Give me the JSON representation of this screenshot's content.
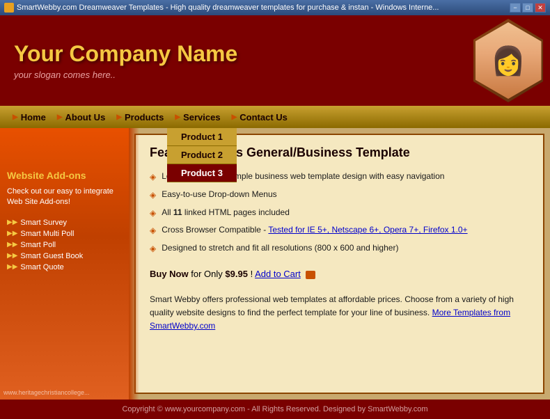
{
  "titlebar": {
    "text": "SmartWebby.com Dreamweaver Templates - High quality dreamweaver templates for purchase & instan - Windows Interne...",
    "minimize": "−",
    "maximize": "□",
    "close": "✕"
  },
  "header": {
    "company_name": "Your Company Name",
    "slogan": "your slogan comes here..",
    "person_emoji": "👩"
  },
  "nav": {
    "home": "Home",
    "about_us": "About Us",
    "products": "Products",
    "services": "Services",
    "contact_us": "Contact Us"
  },
  "dropdown": {
    "item1": "Product 1",
    "item2": "Product 2",
    "item3": "Product 3"
  },
  "sidebar": {
    "title": "Website Add-ons",
    "description": "Check out our easy to integrate Web Site Add-ons!",
    "links": [
      "Smart Survey",
      "Smart Multi Poll",
      "Smart Poll",
      "Smart Guest Book",
      "Smart Quote"
    ],
    "bottom_text": "www.heritagechristiancollege..."
  },
  "content": {
    "title": "Features of this General/Business Template",
    "features": [
      "Low-cost smart & simple business web template design with easy navigation",
      "Easy-to-use Drop-down Menus",
      "All 11 linked HTML pages included",
      "Cross Browser Compatible - Tested for IE 5+, Netscape 6+, Opera 7+, Firefox 1.0+",
      "Designed to stretch and fit all resolutions (800 x 600 and higher)"
    ],
    "feature_bold": "11",
    "cross_browser_label": "Cross Browser Compatible - ",
    "cross_browser_link": "Tested for IE 5+, Netscape 6+, Opera 7+, Firefox 1.0+",
    "buy_now": "Buy Now",
    "buy_text": "for Only",
    "price": "$9.95",
    "buy_suffix": "!",
    "add_to_cart": "Add to Cart",
    "body_text": "Smart Webby offers professional web templates at affordable prices. Choose from a variety of high quality website designs to find the perfect template for your line of business.",
    "more_link": "More Templates from SmartWebby.com"
  },
  "footer": {
    "text": "Copyright © www.yourcompany.com - All Rights Reserved. Designed by SmartWebby.com"
  }
}
